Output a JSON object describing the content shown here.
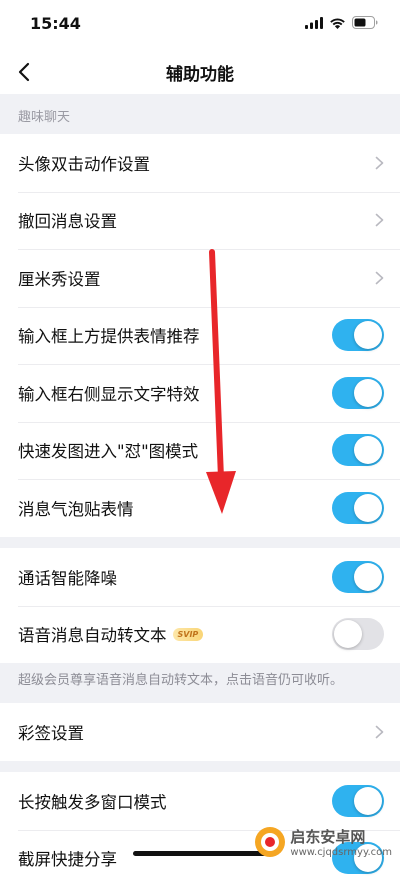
{
  "status_bar": {
    "time": "15:44"
  },
  "nav": {
    "title": "辅助功能"
  },
  "section_fun": {
    "header": "趣味聊天"
  },
  "fun_items": [
    {
      "label": "头像双击动作设置",
      "control": "chevron"
    },
    {
      "label": "撤回消息设置",
      "control": "chevron"
    },
    {
      "label": "厘米秀设置",
      "control": "chevron"
    },
    {
      "label": "输入框上方提供表情推荐",
      "control": "toggle",
      "on": true
    },
    {
      "label": "输入框右侧显示文字特效",
      "control": "toggle",
      "on": true
    },
    {
      "label": "快速发图进入\"怼\"图模式",
      "control": "toggle",
      "on": true
    },
    {
      "label": "消息气泡贴表情",
      "control": "toggle",
      "on": true
    }
  ],
  "voice_items": [
    {
      "label": "通话智能降噪",
      "control": "toggle",
      "on": true
    },
    {
      "label": "语音消息自动转文本",
      "badge": "SVIP",
      "control": "toggle",
      "on": false
    }
  ],
  "voice_note": "超级会员尊享语音消息自动转文本，点击语音仍可收听。",
  "sign_items": [
    {
      "label": "彩签设置",
      "control": "chevron"
    }
  ],
  "window_items": [
    {
      "label": "长按触发多窗口模式",
      "control": "toggle",
      "on": true
    },
    {
      "label": "截屏快捷分享",
      "control": "toggle",
      "on": true
    }
  ],
  "watermark": {
    "name": "启东安卓网",
    "url": "www.cjqdsrmyy.com"
  },
  "colors": {
    "toggle_on": "#2fb2ef",
    "toggle_off": "#e2e2e6",
    "arrow": "#e8262a",
    "background": "#f0f1f5"
  }
}
